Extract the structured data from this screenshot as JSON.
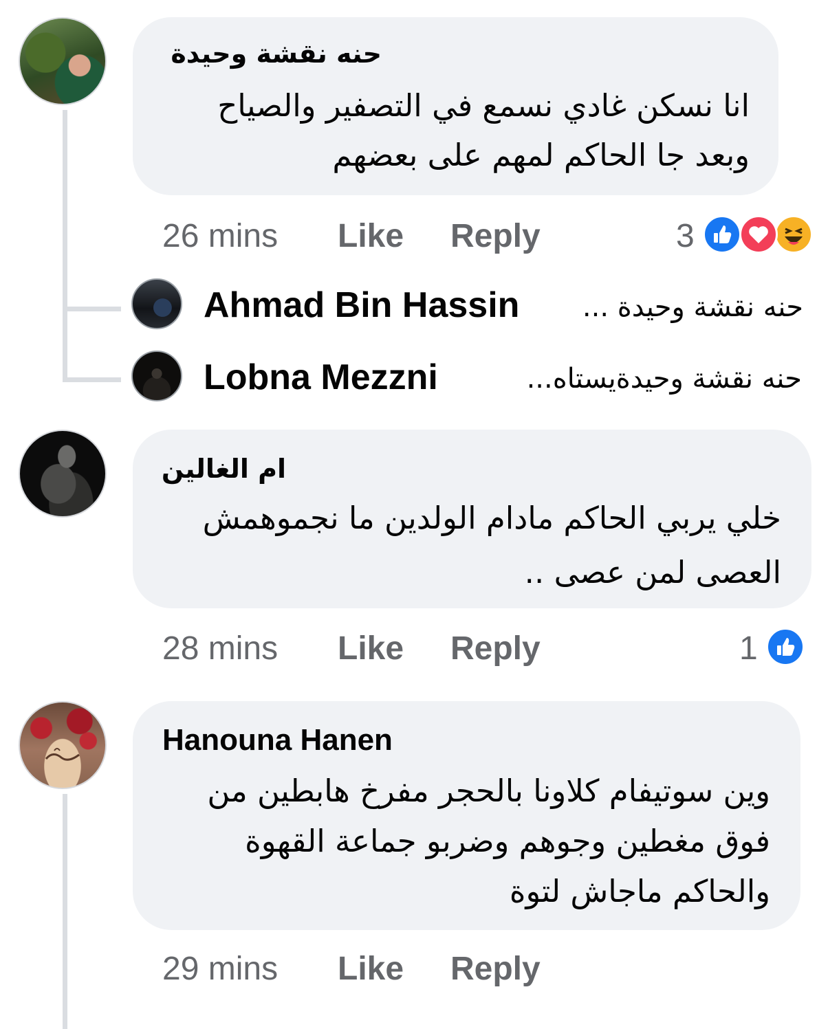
{
  "comments": [
    {
      "author": "حنه نقشة وحيدة",
      "text_lines": [
        "انا نسكن غادي نسمع في التصفير والصياح",
        "وبعد جا الحاكم لمهم على بعضهم"
      ],
      "time": "26 mins",
      "like_label": "Like",
      "reply_label": "Reply",
      "reaction_count": "3",
      "reactions": [
        "like-icon",
        "love-icon",
        "haha-icon"
      ],
      "replies": [
        {
          "author": "Ahmad Bin Hassin",
          "preview": "حنه نقشة وحيدة ..."
        },
        {
          "author": "Lobna Mezzni",
          "preview": "حنه نقشة وحيدةيستاه..."
        }
      ]
    },
    {
      "author": "ام الغالين",
      "text_lines": [
        "خلي يربي الحاكم مادام الولدين ما نجموهمش",
        "العصى لمن عصى .."
      ],
      "time": "28 mins",
      "like_label": "Like",
      "reply_label": "Reply",
      "reaction_count": "1",
      "reactions": [
        "like-icon"
      ]
    },
    {
      "author": "Hanouna Hanen",
      "text_lines": [
        "وين سوتيفام كلاونا بالحجر مفرخ هابطين من",
        "فوق مغطين وجوهم وضربو جماعة القهوة",
        "والحاكم ماجاش لتوة"
      ],
      "time": "29 mins",
      "like_label": "Like",
      "reply_label": "Reply"
    }
  ],
  "colors": {
    "bubble": "#f0f2f5",
    "meta_text": "#65676b",
    "like_blue": "#1877f2",
    "love_red": "#f33e58",
    "haha_yellow": "#f7b125",
    "thread_line": "#dadde1"
  }
}
